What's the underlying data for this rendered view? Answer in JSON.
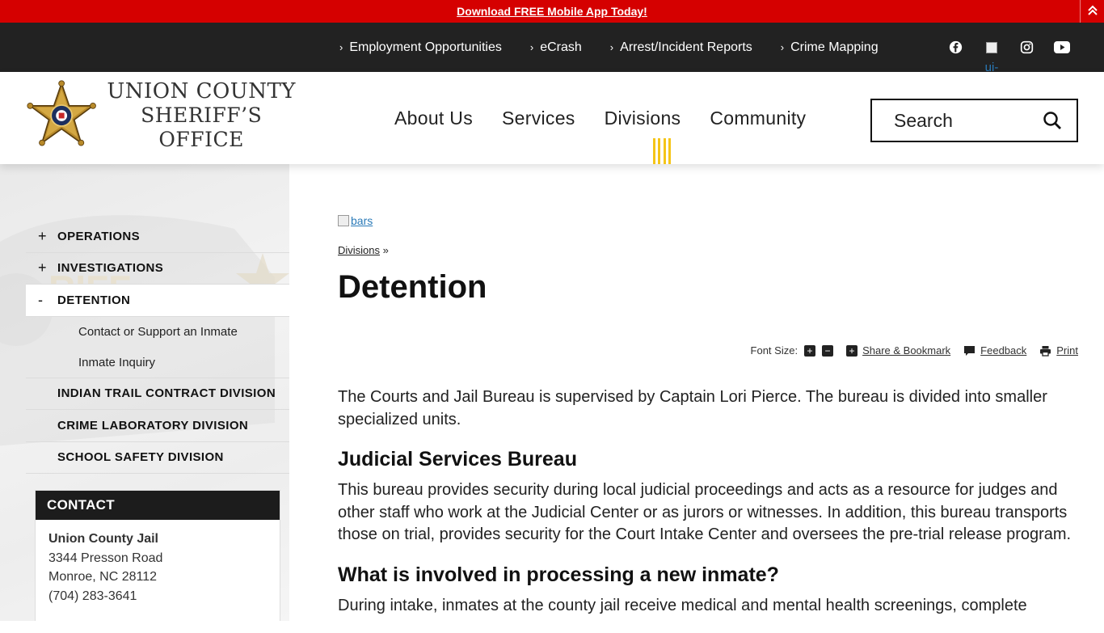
{
  "alert": {
    "link_text": "Download FREE Mobile App Today!"
  },
  "utility": {
    "links": [
      {
        "label": "Employment Opportunities"
      },
      {
        "label": "eCrash"
      },
      {
        "label": "Arrest/Incident Reports"
      },
      {
        "label": "Crime Mapping"
      }
    ],
    "social": [
      "facebook-icon",
      "twitter-icon",
      "instagram-icon",
      "youtube-icon"
    ],
    "twitter_alt": "ui-tw"
  },
  "header": {
    "logo_line1": "UNION COUNTY",
    "logo_line2": "SHERIFF’S OFFICE",
    "nav": [
      {
        "label": "About Us"
      },
      {
        "label": "Services"
      },
      {
        "label": "Divisions"
      },
      {
        "label": "Community"
      }
    ],
    "active_nav": "Divisions",
    "search_placeholder": "Search"
  },
  "sidebar": {
    "items": [
      {
        "label": "OPERATIONS",
        "sign": "+"
      },
      {
        "label": "INVESTIGATIONS",
        "sign": "+"
      },
      {
        "label": "DETENTION",
        "sign": "-"
      },
      {
        "label": "INDIAN TRAIL CONTRACT DIVISION",
        "sign": ""
      },
      {
        "label": "CRIME LABORATORY DIVISION",
        "sign": ""
      },
      {
        "label": "SCHOOL SAFETY DIVISION",
        "sign": ""
      }
    ],
    "subitems": [
      {
        "label": "Contact or Support an Inmate"
      },
      {
        "label": "Inmate Inquiry"
      }
    ],
    "contact": {
      "heading": "CONTACT",
      "name": "Union County Jail",
      "address1": "3344 Presson Road",
      "address2": "Monroe, NC 28112",
      "phone": "(704) 283-3641"
    }
  },
  "main": {
    "bars_alt": "bars",
    "breadcrumb": {
      "link": "Divisions",
      "sep": "»"
    },
    "title": "Detention",
    "tools": {
      "font_size_label": "Font Size:",
      "increase": "+",
      "decrease": "−",
      "share_label": "Share & Bookmark",
      "feedback_label": "Feedback",
      "print_label": "Print"
    },
    "intro": "The Courts and Jail Bureau is supervised by Captain Lori Pierce. The bureau is divided into smaller specialized units.",
    "h_judicial": "Judicial Services Bureau",
    "p_judicial": "This bureau provides security during local judicial proceedings and acts as a resource for judges and other staff who work at the Judicial Center or as jurors or witnesses. In addition, this bureau transports those on trial, provides security for the Court Intake Center and oversees the pre-trial release program.",
    "h_processing": "What is involved in processing a new inmate?",
    "p_processing": "During intake, inmates at the county jail receive medical and mental health screenings, complete"
  },
  "colors": {
    "alert_red": "#d50000",
    "utility_bg": "#222222",
    "active_marker": "#f5c518"
  }
}
